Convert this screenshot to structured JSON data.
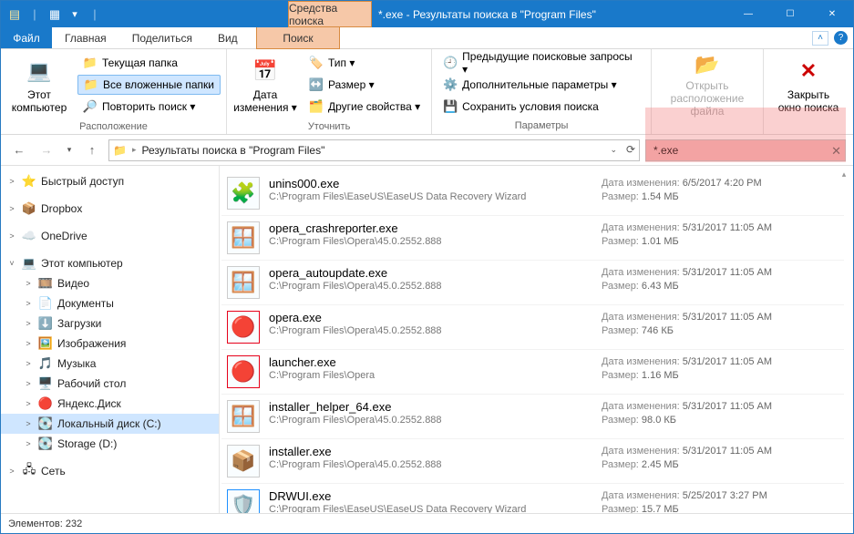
{
  "colors": {
    "accent": "#1979ca",
    "highlight": "#f5baba",
    "context_tab": "#f6c8a8"
  },
  "title": {
    "context_tab": "Средства поиска",
    "text": "*.exe - Результаты поиска в \"Program Files\""
  },
  "qat": [
    "folder-props",
    "new-folder",
    "dropdown"
  ],
  "win_controls": {
    "min": "—",
    "max": "☐",
    "close": "✕"
  },
  "tabs": {
    "file": "Файл",
    "items": [
      "Главная",
      "Поделиться",
      "Вид"
    ],
    "context": "Поиск",
    "chevron": "˄"
  },
  "ribbon": {
    "group1": {
      "label": "Расположение",
      "big": {
        "label": "Этот\nкомпьютер"
      },
      "small": [
        {
          "icon": "📁",
          "label": "Текущая папка"
        },
        {
          "icon": "📁",
          "label": "Все вложенные папки",
          "selected": true
        },
        {
          "icon": "🔎",
          "label": "Повторить поиск ▾"
        }
      ]
    },
    "group2": {
      "label": "Уточнить",
      "big": {
        "label": "Дата\nизменения ▾"
      },
      "small": [
        {
          "icon": "🏷️",
          "label": "Тип ▾"
        },
        {
          "icon": "↔️",
          "label": "Размер ▾"
        },
        {
          "icon": "🗂️",
          "label": "Другие свойства ▾"
        }
      ]
    },
    "group3": {
      "label": "Параметры",
      "small": [
        {
          "icon": "🕘",
          "label": "Предыдущие поисковые запросы ▾"
        },
        {
          "icon": "⚙️",
          "label": "Дополнительные параметры ▾"
        },
        {
          "icon": "💾",
          "label": "Сохранить условия поиска"
        }
      ]
    },
    "open_loc": {
      "label": "Открыть\nрасположение файла",
      "disabled": true
    },
    "close_search": {
      "label": "Закрыть\nокно поиска"
    }
  },
  "address": {
    "back": "←",
    "fwd": "→",
    "recent": "▾",
    "up": "↑",
    "segments": [
      "Результаты поиска в \"Program Files\""
    ],
    "refresh": "⟳"
  },
  "search": {
    "value": "*.exe",
    "clear": "✕"
  },
  "tree": [
    {
      "exp": ">",
      "icon": "⭐",
      "label": "Быстрый доступ",
      "indent": 0
    },
    {
      "exp": ">",
      "icon": "📦",
      "label": "Dropbox",
      "indent": 0,
      "color": "#0061ff"
    },
    {
      "exp": ">",
      "icon": "☁️",
      "label": "OneDrive",
      "indent": 0,
      "color": "#0a7cd4"
    },
    {
      "exp": "˅",
      "icon": "💻",
      "label": "Этот компьютер",
      "indent": 0
    },
    {
      "exp": ">",
      "icon": "🎞️",
      "label": "Видео",
      "indent": 1
    },
    {
      "exp": ">",
      "icon": "📄",
      "label": "Документы",
      "indent": 1
    },
    {
      "exp": ">",
      "icon": "⬇️",
      "label": "Загрузки",
      "indent": 1
    },
    {
      "exp": ">",
      "icon": "🖼️",
      "label": "Изображения",
      "indent": 1
    },
    {
      "exp": ">",
      "icon": "🎵",
      "label": "Музыка",
      "indent": 1
    },
    {
      "exp": ">",
      "icon": "🖥️",
      "label": "Рабочий стол",
      "indent": 1
    },
    {
      "exp": ">",
      "icon": "🔴",
      "label": "Яндекс.Диск",
      "indent": 1
    },
    {
      "exp": ">",
      "icon": "💽",
      "label": "Локальный диск (C:)",
      "indent": 1,
      "selected": true
    },
    {
      "exp": ">",
      "icon": "💽",
      "label": "Storage (D:)",
      "indent": 1
    },
    {
      "exp": ">",
      "icon": "🖧",
      "label": "Сеть",
      "indent": 0
    }
  ],
  "labels": {
    "date_mod": "Дата изменения:",
    "size": "Размер:"
  },
  "files": [
    {
      "icon": "🧩",
      "name": "unins000.exe",
      "path": "C:\\Program Files\\EaseUS\\EaseUS Data Recovery Wizard",
      "date": "6/5/2017 4:20 PM",
      "size": "1.54 МБ"
    },
    {
      "icon": "🪟",
      "name": "opera_crashreporter.exe",
      "path": "C:\\Program Files\\Opera\\45.0.2552.888",
      "date": "5/31/2017 11:05 AM",
      "size": "1.01 МБ"
    },
    {
      "icon": "🪟",
      "name": "opera_autoupdate.exe",
      "path": "C:\\Program Files\\Opera\\45.0.2552.888",
      "date": "5/31/2017 11:05 AM",
      "size": "6.43 МБ"
    },
    {
      "icon": "🔴",
      "name": "opera.exe",
      "path": "C:\\Program Files\\Opera\\45.0.2552.888",
      "date": "5/31/2017 11:05 AM",
      "size": "746 КБ",
      "iconColor": "#e6001a"
    },
    {
      "icon": "🔴",
      "name": "launcher.exe",
      "path": "C:\\Program Files\\Opera",
      "date": "5/31/2017 11:05 AM",
      "size": "1.16 МБ",
      "iconColor": "#e6001a"
    },
    {
      "icon": "🪟",
      "name": "installer_helper_64.exe",
      "path": "C:\\Program Files\\Opera\\45.0.2552.888",
      "date": "5/31/2017 11:05 AM",
      "size": "98.0 КБ"
    },
    {
      "icon": "📦",
      "name": "installer.exe",
      "path": "C:\\Program Files\\Opera\\45.0.2552.888",
      "date": "5/31/2017 11:05 AM",
      "size": "2.45 МБ"
    },
    {
      "icon": "🛡️",
      "name": "DRWUI.exe",
      "path": "C:\\Program Files\\EaseUS\\EaseUS Data Recovery Wizard",
      "date": "5/25/2017 3:27 PM",
      "size": "15.7 МБ",
      "iconColor": "#1e90ff"
    }
  ],
  "status": {
    "count_label": "Элементов:",
    "count": "232"
  }
}
